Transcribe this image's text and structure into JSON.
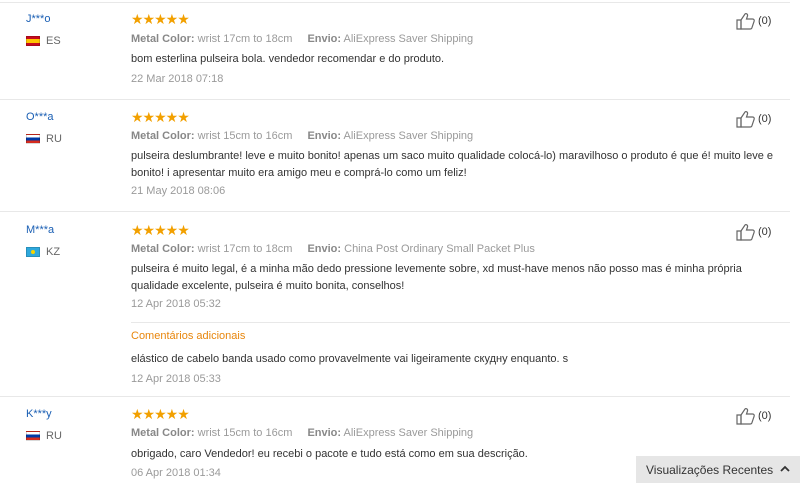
{
  "reviews": [
    {
      "user": "J***o",
      "country": "ES",
      "stars": "★★★★★",
      "color_label": "Metal Color:",
      "color_value": "wrist 17cm to 18cm",
      "ship_label": "Envio:",
      "ship_value": "AliExpress Saver Shipping",
      "text": "bom esterlina pulseira bola. vendedor recomendar e do produto.",
      "date": "22 Mar 2018 07:18",
      "helpful": "(0)"
    },
    {
      "user": "O***a",
      "country": "RU",
      "stars": "★★★★★",
      "color_label": "Metal Color:",
      "color_value": "wrist 15cm to 16cm",
      "ship_label": "Envio:",
      "ship_value": "AliExpress Saver Shipping",
      "text": "pulseira deslumbrante! leve e muito bonito! apenas um saco muito qualidade colocá-lo) maravilhoso o produto é que é! muito leve e bonito! i apresentar muito era amigo meu e comprá-lo como um feliz!",
      "date": "21 May 2018 08:06",
      "helpful": "(0)"
    },
    {
      "user": "M***a",
      "country": "KZ",
      "stars": "★★★★★",
      "color_label": "Metal Color:",
      "color_value": "wrist 17cm to 18cm",
      "ship_label": "Envio:",
      "ship_value": "China Post Ordinary Small Packet Plus",
      "text": "pulseira é muito legal, é a minha mão dedo pressione levemente sobre, xd must-have menos não posso mas é minha própria qualidade excelente, pulseira é muito bonita, conselhos!",
      "date": "12 Apr 2018 05:32",
      "helpful": "(0)",
      "additional_title": "Comentários adicionais",
      "additional_text": "elástico de cabelo banda usado como provavelmente vai ligeiramente скудну enquanto. s",
      "additional_date": "12 Apr 2018 05:33"
    },
    {
      "user": "K***y",
      "country": "RU",
      "stars": "★★★★★",
      "color_label": "Metal Color:",
      "color_value": "wrist 15cm to 16cm",
      "ship_label": "Envio:",
      "ship_value": "AliExpress Saver Shipping",
      "text": "obrigado, caro Vendedor! eu recebi o pacote e tudo está como em sua descrição.",
      "date": "06 Apr 2018 01:34",
      "helpful": "(0)"
    }
  ],
  "recent_views": {
    "label": "Visualizações Recentes"
  },
  "colors": {
    "stars": "#f2a000",
    "username": "#1a5fb4",
    "additional_title": "#e8860c"
  },
  "icons": {
    "helpful": "thumbs-up-icon",
    "expand": "chevron-up-icon"
  }
}
